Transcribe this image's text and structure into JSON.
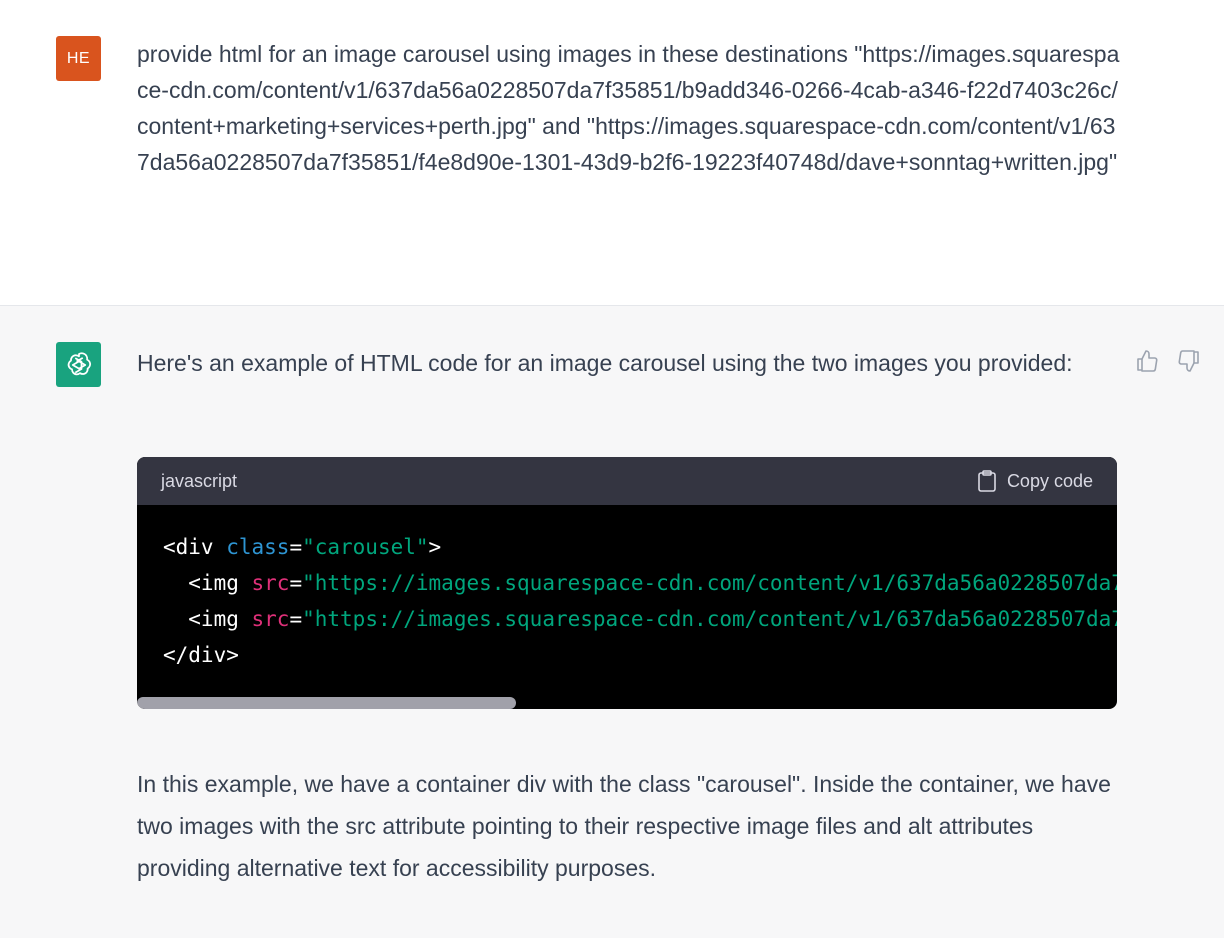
{
  "user_message": {
    "avatar_initials": "HE",
    "avatar_color": "#d9541e",
    "text": "provide html for an image carousel using images in these destinations \"https://images.squarespace-cdn.com/content/v1/637da56a0228507da7f35851/b9add346-0266-4cab-a346-f22d7403c26c/content+marketing+services+perth.jpg\" and \"https://images.squarespace-cdn.com/content/v1/637da56a0228507da7f35851/f4e8d90e-1301-43d9-b2f6-19223f40748d/dave+sonntag+written.jpg\""
  },
  "assistant_message": {
    "avatar_icon": "openai-logo-icon",
    "avatar_color": "#19a37f",
    "intro": "Here's an example of HTML code for an image carousel using the two images you provided:",
    "code_block": {
      "language": "javascript",
      "copy_label": "Copy code",
      "copy_icon": "clipboard-icon",
      "lines": {
        "l1_open": "<div ",
        "l1_attr": "class",
        "l1_eq": "=",
        "l1_val": "\"carousel\"",
        "l1_close": ">",
        "l2_open": "  <img ",
        "l2_attr": "src",
        "l2_eq": "=",
        "l2_val": "\"https://images.squarespace-cdn.com/content/v1/637da56a0228507da7",
        "l3_open": "  <img ",
        "l3_attr": "src",
        "l3_eq": "=",
        "l3_val": "\"https://images.squarespace-cdn.com/content/v1/637da56a0228507da7",
        "l4": "</div>"
      }
    },
    "explanation": "In this example, we have a container div with the class \"carousel\". Inside the container, we have two images with the src attribute pointing to their respective image files and alt attributes providing alternative text for accessibility purposes.",
    "feedback": {
      "thumbs_up_icon": "thumbs-up-icon",
      "thumbs_down_icon": "thumbs-down-icon"
    }
  }
}
